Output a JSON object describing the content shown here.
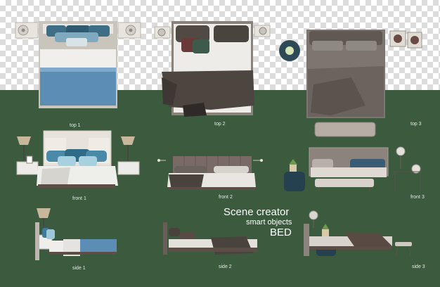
{
  "colors": {
    "background_green": "#3b5a3e",
    "checker_light": "#ffffff",
    "checker_dark": "#dcdcdc",
    "label_text": "#e6ece6",
    "title_text": "#ffffff",
    "blue_bedding": "#5b8db5",
    "grey_bedding": "#6b645e",
    "dark_throw": "#4a423d"
  },
  "labels": {
    "top1": "top 1",
    "top2": "top 2",
    "top3": "top 3",
    "front1": "front 1",
    "front2": "front 2",
    "front3": "front 3",
    "side1": "side 1",
    "side2": "side 2",
    "side3": "side 3"
  },
  "title": {
    "line1": "Scene creator",
    "line2": "smart objects",
    "line3": "BED"
  }
}
